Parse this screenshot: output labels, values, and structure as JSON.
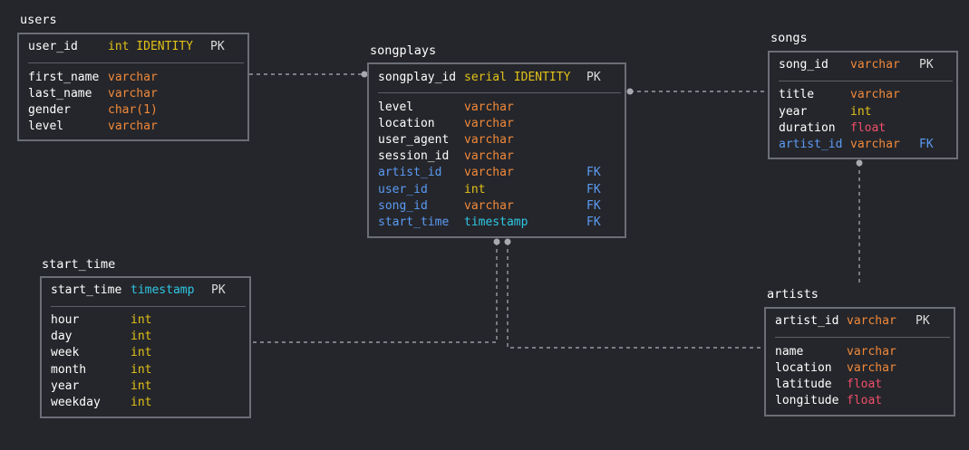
{
  "tables": {
    "users": {
      "name": "users",
      "pk": {
        "name": "user_id",
        "type": "int IDENTITY",
        "key": "PK"
      },
      "columns": [
        {
          "name": "first_name",
          "type": "varchar"
        },
        {
          "name": "last_name",
          "type": "varchar"
        },
        {
          "name": "gender",
          "type": "char(1)"
        },
        {
          "name": "level",
          "type": "varchar"
        }
      ]
    },
    "songplays": {
      "name": "songplays",
      "pk": {
        "name": "songplay_id",
        "type": "serial IDENTITY",
        "key": "PK"
      },
      "columns": [
        {
          "name": "level",
          "type": "varchar"
        },
        {
          "name": "location",
          "type": "varchar"
        },
        {
          "name": "user_agent",
          "type": "varchar"
        },
        {
          "name": "session_id",
          "type": "varchar"
        },
        {
          "name": "artist_id",
          "type": "varchar",
          "key": "FK"
        },
        {
          "name": "user_id",
          "type": "int",
          "key": "FK"
        },
        {
          "name": "song_id",
          "type": "varchar",
          "key": "FK"
        },
        {
          "name": "start_time",
          "type": "timestamp",
          "key": "FK"
        }
      ]
    },
    "songs": {
      "name": "songs",
      "pk": {
        "name": "song_id",
        "type": "varchar",
        "key": "PK"
      },
      "columns": [
        {
          "name": "title",
          "type": "varchar"
        },
        {
          "name": "year",
          "type": "int"
        },
        {
          "name": "duration",
          "type": "float"
        },
        {
          "name": "artist_id",
          "type": "varchar",
          "key": "FK"
        }
      ]
    },
    "start_time": {
      "name": "start_time",
      "pk": {
        "name": "start_time",
        "type": "timestamp",
        "key": "PK"
      },
      "columns": [
        {
          "name": "hour",
          "type": "int"
        },
        {
          "name": "day",
          "type": "int"
        },
        {
          "name": "week",
          "type": "int"
        },
        {
          "name": "month",
          "type": "int"
        },
        {
          "name": "year",
          "type": "int"
        },
        {
          "name": "weekday",
          "type": "int"
        }
      ]
    },
    "artists": {
      "name": "artists",
      "pk": {
        "name": "artist_id",
        "type": "varchar",
        "key": "PK"
      },
      "columns": [
        {
          "name": "name",
          "type": "varchar"
        },
        {
          "name": "location",
          "type": "varchar"
        },
        {
          "name": "latitude",
          "type": "float"
        },
        {
          "name": "longitude",
          "type": "float"
        }
      ]
    }
  },
  "relationships": [
    {
      "from": "songplays.user_id",
      "to": "users.user_id"
    },
    {
      "from": "songplays.song_id",
      "to": "songs.song_id"
    },
    {
      "from": "songplays.start_time",
      "to": "start_time.start_time"
    },
    {
      "from": "songplays.artist_id",
      "to": "artists.artist_id"
    },
    {
      "from": "songs.artist_id",
      "to": "artists.artist_id"
    }
  ],
  "colors": {
    "background": "#25262b",
    "border": "#6b6e76",
    "connector": "#9a9ca3",
    "varchar": "#f1893a",
    "int": "#e2c219",
    "float": "#ef4f6a",
    "timestamp": "#2fc7e4",
    "fk": "#5b9bf3"
  }
}
